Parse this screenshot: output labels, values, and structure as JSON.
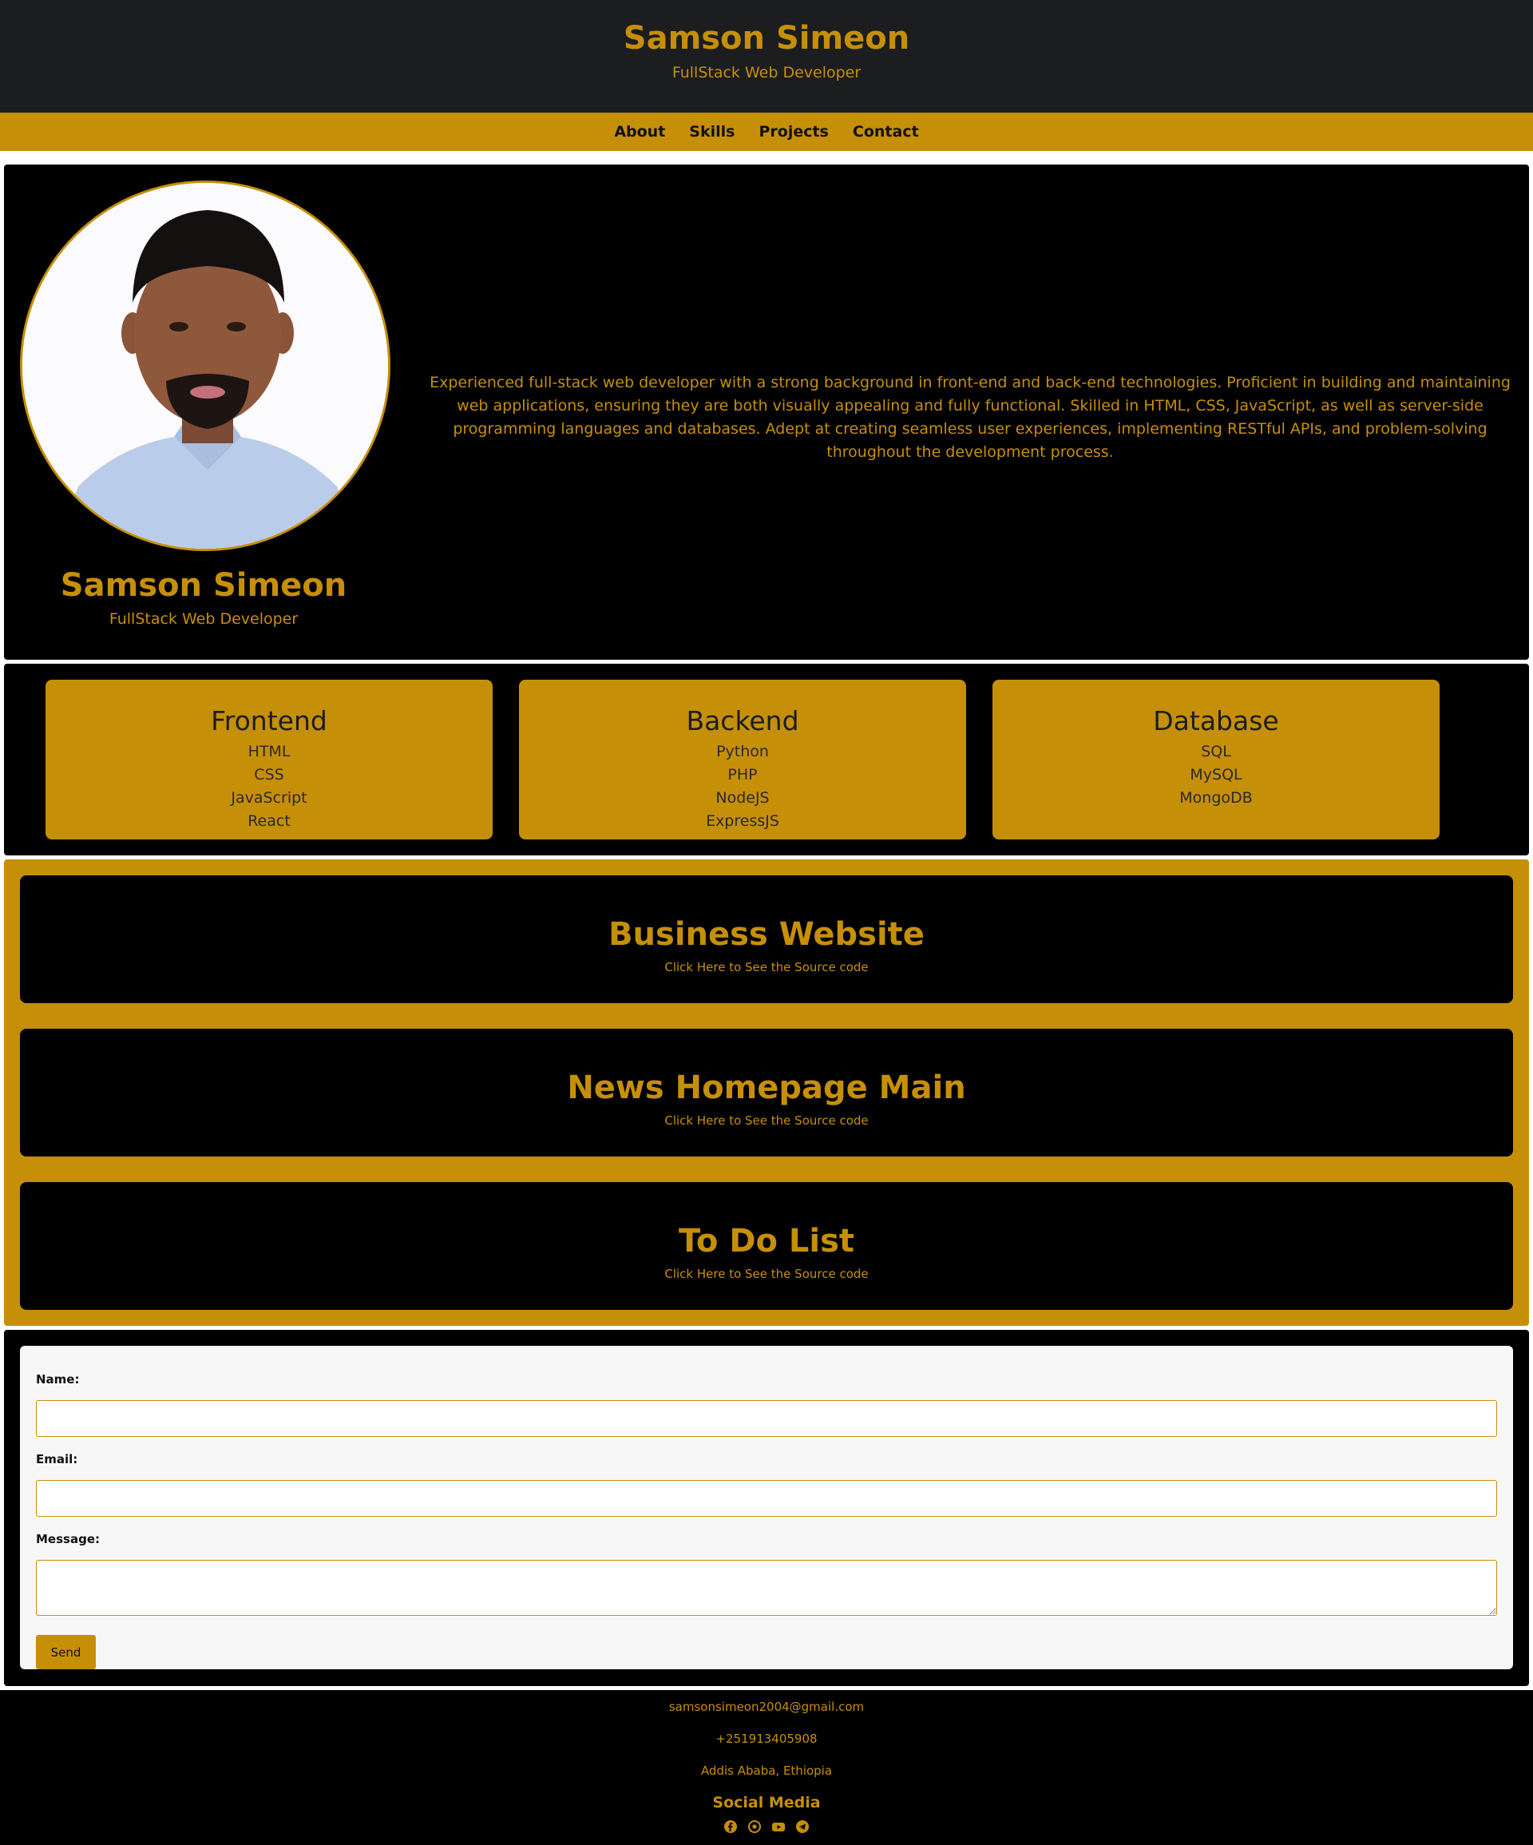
{
  "header": {
    "name": "Samson Simeon",
    "role": "FullStack Web Developer"
  },
  "nav": {
    "items": [
      "About",
      "Skills",
      "Projects",
      "Contact"
    ]
  },
  "about": {
    "name": "Samson Simeon",
    "role": "FullStack Web Developer",
    "bio": "Experienced full-stack web developer with a strong background in front-end and back-end technologies. Proficient in building and maintaining web applications, ensuring they are both visually appealing and fully functional. Skilled in HTML, CSS, JavaScript, as well as server-side programming languages and databases. Adept at creating seamless user experiences, implementing RESTful APIs, and problem-solving throughout the development process."
  },
  "skills": [
    {
      "title": "Frontend",
      "items": [
        "HTML",
        "CSS",
        "JavaScript",
        "React"
      ]
    },
    {
      "title": "Backend",
      "items": [
        "Python",
        "PHP",
        "NodeJS",
        "ExpressJS"
      ]
    },
    {
      "title": "Database",
      "items": [
        "SQL",
        "MySQL",
        "MongoDB"
      ]
    }
  ],
  "projects": [
    {
      "title": "Business Website",
      "link": "Click Here to See the Source code"
    },
    {
      "title": "News Homepage Main",
      "link": "Click Here to See the Source code"
    },
    {
      "title": "To Do List",
      "link": "Click Here to See the Source code"
    }
  ],
  "contact": {
    "name_label": "Name:",
    "email_label": "Email:",
    "message_label": "Message:",
    "send_label": "Send"
  },
  "footer": {
    "email": "samsonsimeon2004@gmail.com",
    "phone": "+251913405908",
    "location": "Addis Ababa, Ethiopia",
    "social_title": "Social Media",
    "social_icons": [
      "facebook-icon",
      "whatsapp-icon",
      "youtube-icon",
      "telegram-icon"
    ]
  },
  "colors": {
    "accent": "#c68f08",
    "header_bg": "#1c1d1f",
    "panel_bg": "#000000",
    "form_bg": "#f7f7f7"
  }
}
